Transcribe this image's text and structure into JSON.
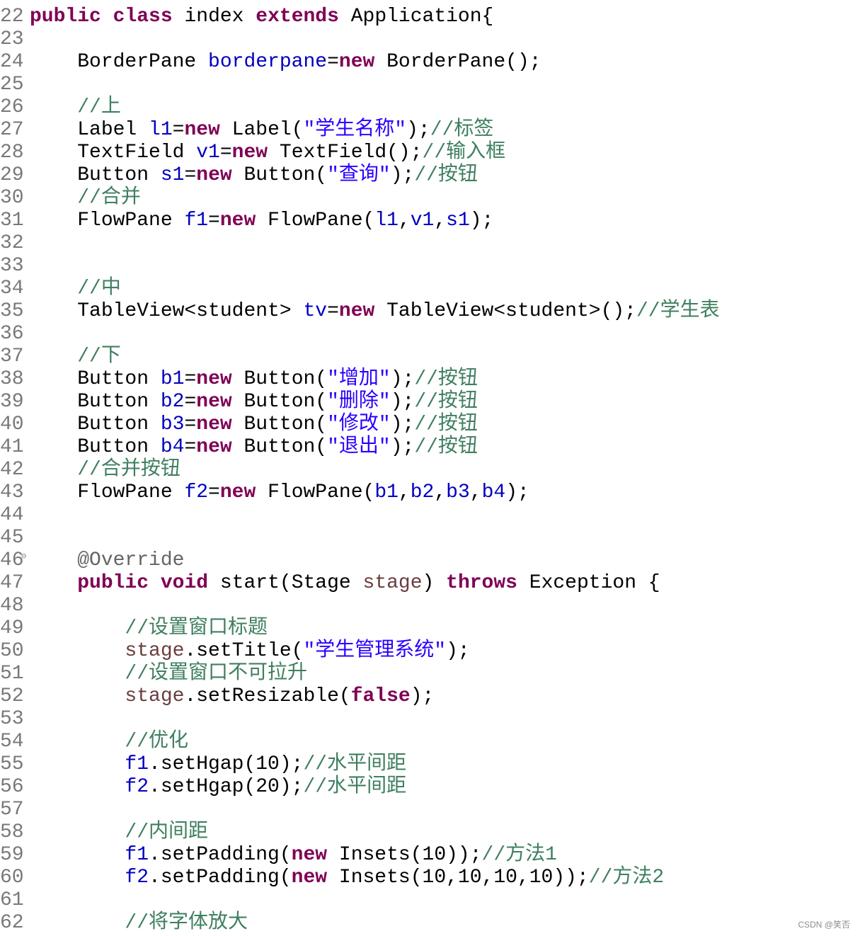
{
  "watermark": "CSDN @笑否",
  "lines": [
    {
      "n": "22",
      "tokens": [
        {
          "t": "public",
          "c": "kw"
        },
        {
          "t": " "
        },
        {
          "t": "class",
          "c": "kw"
        },
        {
          "t": " index "
        },
        {
          "t": "extends",
          "c": "kw"
        },
        {
          "t": " Application{"
        }
      ]
    },
    {
      "n": "23",
      "tokens": []
    },
    {
      "n": "24",
      "tokens": [
        {
          "t": "    BorderPane "
        },
        {
          "t": "borderpane",
          "c": "fld"
        },
        {
          "t": "="
        },
        {
          "t": "new",
          "c": "kw"
        },
        {
          "t": " BorderPane();"
        }
      ]
    },
    {
      "n": "25",
      "tokens": []
    },
    {
      "n": "26",
      "tokens": [
        {
          "t": "    "
        },
        {
          "t": "//上",
          "c": "cm"
        }
      ]
    },
    {
      "n": "27",
      "tokens": [
        {
          "t": "    Label "
        },
        {
          "t": "l1",
          "c": "fld"
        },
        {
          "t": "="
        },
        {
          "t": "new",
          "c": "kw"
        },
        {
          "t": " Label("
        },
        {
          "t": "\"学生名称\"",
          "c": "str"
        },
        {
          "t": ");"
        },
        {
          "t": "//标签",
          "c": "cm"
        }
      ]
    },
    {
      "n": "28",
      "tokens": [
        {
          "t": "    TextField "
        },
        {
          "t": "v1",
          "c": "fld"
        },
        {
          "t": "="
        },
        {
          "t": "new",
          "c": "kw"
        },
        {
          "t": " TextField();"
        },
        {
          "t": "//输入框",
          "c": "cm"
        }
      ]
    },
    {
      "n": "29",
      "tokens": [
        {
          "t": "    Button "
        },
        {
          "t": "s1",
          "c": "fld"
        },
        {
          "t": "="
        },
        {
          "t": "new",
          "c": "kw"
        },
        {
          "t": " Button("
        },
        {
          "t": "\"查询\"",
          "c": "str"
        },
        {
          "t": ");"
        },
        {
          "t": "//按钮",
          "c": "cm"
        }
      ]
    },
    {
      "n": "30",
      "tokens": [
        {
          "t": "    "
        },
        {
          "t": "//合并",
          "c": "cm"
        }
      ]
    },
    {
      "n": "31",
      "tokens": [
        {
          "t": "    FlowPane "
        },
        {
          "t": "f1",
          "c": "fld"
        },
        {
          "t": "="
        },
        {
          "t": "new",
          "c": "kw"
        },
        {
          "t": " FlowPane("
        },
        {
          "t": "l1",
          "c": "fld"
        },
        {
          "t": ","
        },
        {
          "t": "v1",
          "c": "fld"
        },
        {
          "t": ","
        },
        {
          "t": "s1",
          "c": "fld"
        },
        {
          "t": ");"
        }
      ]
    },
    {
      "n": "32",
      "tokens": []
    },
    {
      "n": "33",
      "tokens": []
    },
    {
      "n": "34",
      "tokens": [
        {
          "t": "    "
        },
        {
          "t": "//中",
          "c": "cm"
        }
      ]
    },
    {
      "n": "35",
      "tokens": [
        {
          "t": "    TableView<student> "
        },
        {
          "t": "tv",
          "c": "fld"
        },
        {
          "t": "="
        },
        {
          "t": "new",
          "c": "kw"
        },
        {
          "t": " TableView<student>();"
        },
        {
          "t": "//学生表",
          "c": "cm"
        }
      ]
    },
    {
      "n": "36",
      "tokens": []
    },
    {
      "n": "37",
      "tokens": [
        {
          "t": "    "
        },
        {
          "t": "//下",
          "c": "cm"
        }
      ]
    },
    {
      "n": "38",
      "tokens": [
        {
          "t": "    Button "
        },
        {
          "t": "b1",
          "c": "fld"
        },
        {
          "t": "="
        },
        {
          "t": "new",
          "c": "kw"
        },
        {
          "t": " Button("
        },
        {
          "t": "\"增加\"",
          "c": "str"
        },
        {
          "t": ");"
        },
        {
          "t": "//按钮",
          "c": "cm"
        }
      ]
    },
    {
      "n": "39",
      "tokens": [
        {
          "t": "    Button "
        },
        {
          "t": "b2",
          "c": "fld"
        },
        {
          "t": "="
        },
        {
          "t": "new",
          "c": "kw"
        },
        {
          "t": " Button("
        },
        {
          "t": "\"删除\"",
          "c": "str"
        },
        {
          "t": ");"
        },
        {
          "t": "//按钮",
          "c": "cm"
        }
      ]
    },
    {
      "n": "40",
      "tokens": [
        {
          "t": "    Button "
        },
        {
          "t": "b3",
          "c": "fld"
        },
        {
          "t": "="
        },
        {
          "t": "new",
          "c": "kw"
        },
        {
          "t": " Button("
        },
        {
          "t": "\"修改\"",
          "c": "str"
        },
        {
          "t": ");"
        },
        {
          "t": "//按钮",
          "c": "cm"
        }
      ]
    },
    {
      "n": "41",
      "tokens": [
        {
          "t": "    Button "
        },
        {
          "t": "b4",
          "c": "fld"
        },
        {
          "t": "="
        },
        {
          "t": "new",
          "c": "kw"
        },
        {
          "t": " Button("
        },
        {
          "t": "\"退出\"",
          "c": "str"
        },
        {
          "t": ");"
        },
        {
          "t": "//按钮",
          "c": "cm"
        }
      ]
    },
    {
      "n": "42",
      "tokens": [
        {
          "t": "    "
        },
        {
          "t": "//合并按钮",
          "c": "cm"
        }
      ]
    },
    {
      "n": "43",
      "tokens": [
        {
          "t": "    FlowPane "
        },
        {
          "t": "f2",
          "c": "fld"
        },
        {
          "t": "="
        },
        {
          "t": "new",
          "c": "kw"
        },
        {
          "t": " FlowPane("
        },
        {
          "t": "b1",
          "c": "fld"
        },
        {
          "t": ","
        },
        {
          "t": "b2",
          "c": "fld"
        },
        {
          "t": ","
        },
        {
          "t": "b3",
          "c": "fld"
        },
        {
          "t": ","
        },
        {
          "t": "b4",
          "c": "fld"
        },
        {
          "t": ");"
        }
      ]
    },
    {
      "n": "44",
      "tokens": []
    },
    {
      "n": "45",
      "tokens": []
    },
    {
      "n": "46",
      "fold": "⊖",
      "tokens": [
        {
          "t": "    "
        },
        {
          "t": "@Override",
          "c": "ann"
        }
      ]
    },
    {
      "n": "47",
      "tokens": [
        {
          "t": "    "
        },
        {
          "t": "public",
          "c": "kw"
        },
        {
          "t": " "
        },
        {
          "t": "void",
          "c": "kw"
        },
        {
          "t": " start(Stage "
        },
        {
          "t": "stage",
          "c": "var"
        },
        {
          "t": ") "
        },
        {
          "t": "throws",
          "c": "kw"
        },
        {
          "t": " Exception {"
        }
      ]
    },
    {
      "n": "48",
      "tokens": []
    },
    {
      "n": "49",
      "tokens": [
        {
          "t": "        "
        },
        {
          "t": "//设置窗口标题",
          "c": "cm"
        }
      ]
    },
    {
      "n": "50",
      "tokens": [
        {
          "t": "        "
        },
        {
          "t": "stage",
          "c": "var"
        },
        {
          "t": ".setTitle("
        },
        {
          "t": "\"学生管理系统\"",
          "c": "str"
        },
        {
          "t": ");"
        }
      ]
    },
    {
      "n": "51",
      "tokens": [
        {
          "t": "        "
        },
        {
          "t": "//设置窗口不可拉升",
          "c": "cm"
        }
      ]
    },
    {
      "n": "52",
      "tokens": [
        {
          "t": "        "
        },
        {
          "t": "stage",
          "c": "var"
        },
        {
          "t": ".setResizable("
        },
        {
          "t": "false",
          "c": "kw"
        },
        {
          "t": ");"
        }
      ]
    },
    {
      "n": "53",
      "tokens": []
    },
    {
      "n": "54",
      "tokens": [
        {
          "t": "        "
        },
        {
          "t": "//优化",
          "c": "cm"
        }
      ]
    },
    {
      "n": "55",
      "tokens": [
        {
          "t": "        "
        },
        {
          "t": "f1",
          "c": "fld"
        },
        {
          "t": ".setHgap(10);"
        },
        {
          "t": "//水平间距",
          "c": "cm"
        }
      ]
    },
    {
      "n": "56",
      "tokens": [
        {
          "t": "        "
        },
        {
          "t": "f2",
          "c": "fld"
        },
        {
          "t": ".setHgap(20);"
        },
        {
          "t": "//水平间距",
          "c": "cm"
        }
      ]
    },
    {
      "n": "57",
      "tokens": []
    },
    {
      "n": "58",
      "tokens": [
        {
          "t": "        "
        },
        {
          "t": "//内间距",
          "c": "cm"
        }
      ]
    },
    {
      "n": "59",
      "tokens": [
        {
          "t": "        "
        },
        {
          "t": "f1",
          "c": "fld"
        },
        {
          "t": ".setPadding("
        },
        {
          "t": "new",
          "c": "kw"
        },
        {
          "t": " Insets(10));"
        },
        {
          "t": "//方法1",
          "c": "cm"
        }
      ]
    },
    {
      "n": "60",
      "tokens": [
        {
          "t": "        "
        },
        {
          "t": "f2",
          "c": "fld"
        },
        {
          "t": ".setPadding("
        },
        {
          "t": "new",
          "c": "kw"
        },
        {
          "t": " Insets(10,10,10,10));"
        },
        {
          "t": "//方法2",
          "c": "cm"
        }
      ]
    },
    {
      "n": "61",
      "tokens": []
    },
    {
      "n": "62",
      "tokens": [
        {
          "t": "        "
        },
        {
          "t": "//将字体放大",
          "c": "cm"
        }
      ]
    }
  ]
}
